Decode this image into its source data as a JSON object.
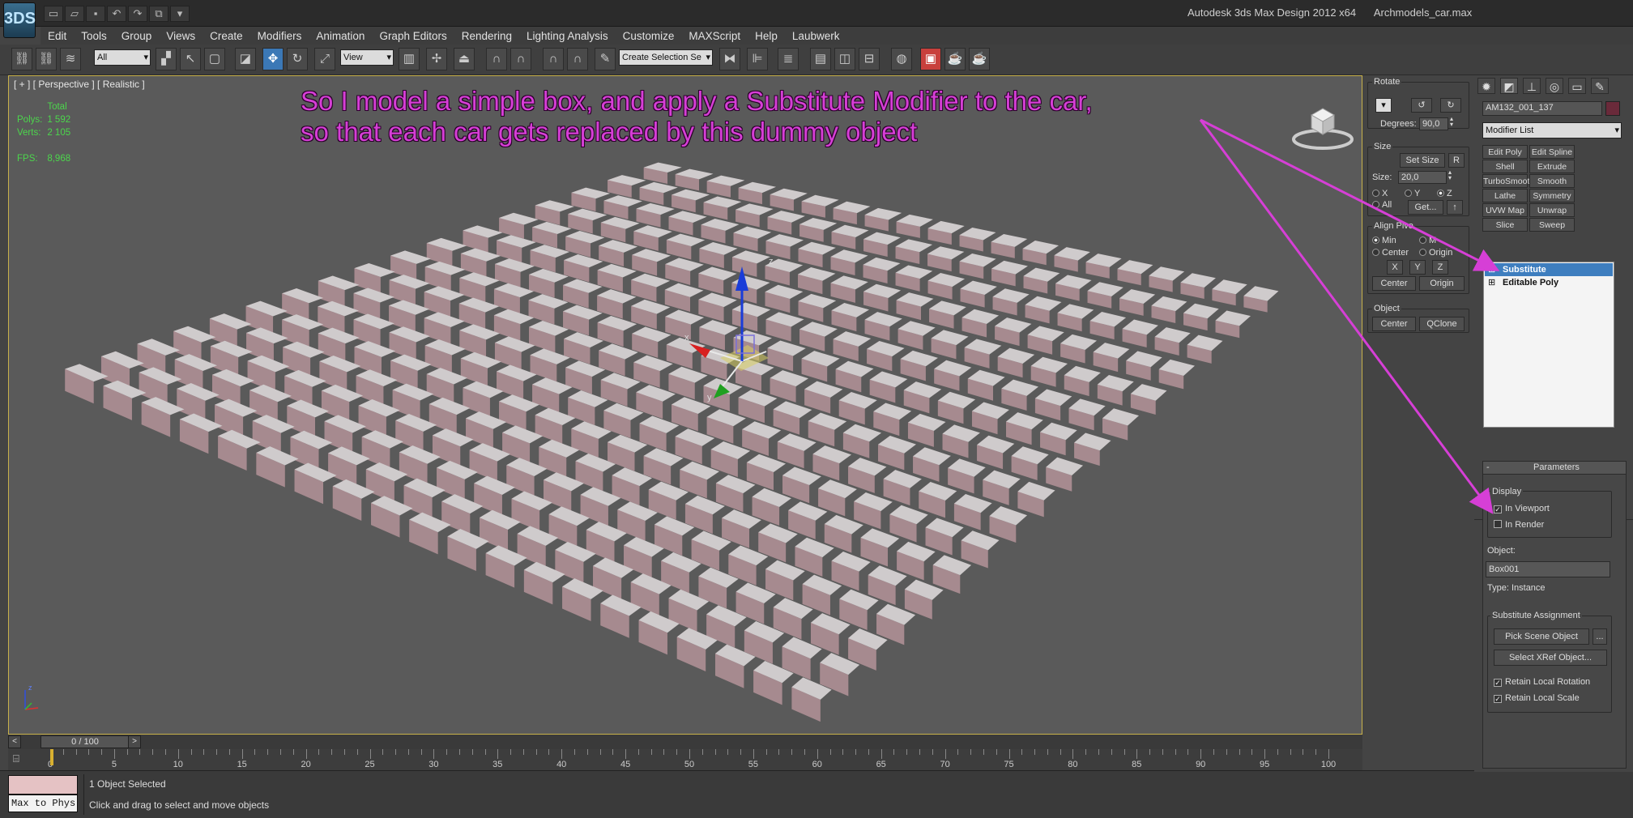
{
  "window": {
    "app_logo": "3DS",
    "title": "Autodesk 3ds Max Design 2012 x64",
    "filename": "Archmodels_car.max"
  },
  "menu": [
    "Edit",
    "Tools",
    "Group",
    "Views",
    "Create",
    "Modifiers",
    "Animation",
    "Graph Editors",
    "Rendering",
    "Lighting Analysis",
    "Customize",
    "MAXScript",
    "Help",
    "Laubwerk"
  ],
  "toolbar": {
    "selection_filter": "All",
    "reference_coord": "View",
    "named_selection": "Create Selection Se"
  },
  "viewport": {
    "label": "[ + ] [ Perspective ] [ Realistic ]",
    "stats": {
      "total_label": "Total",
      "polys_label": "Polys:",
      "polys_value": "1 592",
      "verts_label": "Verts:",
      "verts_value": "2 105",
      "fps_label": "FPS:",
      "fps_value": "8,968"
    },
    "annotation_line1": "So I model a simple box, and apply a Substitute Modifier to the car,",
    "annotation_line2": "so that each car gets replaced by this dummy object",
    "gizmo_z": "z",
    "gizmo_x": "x",
    "gizmo_y": "y",
    "tripod_z": "z"
  },
  "timeline": {
    "frame_display": "0 / 100",
    "prev": "<",
    "next": ">",
    "tick_labels": [
      "0",
      "5",
      "10",
      "15",
      "20",
      "25",
      "30",
      "35",
      "40",
      "45",
      "50",
      "55",
      "60",
      "65",
      "70",
      "75",
      "80",
      "85",
      "90",
      "95",
      "100"
    ]
  },
  "status": {
    "maxscript_label": "Max to Phys",
    "selection": "1 Object Selected",
    "prompt": "Click and drag to select and move objects"
  },
  "align_panel": {
    "rotate_title": "Rotate",
    "degrees_label": "Degrees:",
    "degrees_value": "90,0",
    "size_title": "Size",
    "set_size": "Set Size",
    "r_button": "R",
    "size_label": "Size:",
    "size_value": "20,0",
    "axis_x": "X",
    "axis_y": "Y",
    "axis_z": "Z",
    "axis_all": "All",
    "get_button": "Get...",
    "align_pivot_title": "Align Pivo",
    "min": "Min",
    "max": "M",
    "center": "Center",
    "origin": "Origin",
    "btn_x": "X",
    "btn_y": "Y",
    "btn_z": "Z",
    "btn_center": "Center",
    "btn_origin": "Origin",
    "object_title": "Object",
    "obj_center": "Center",
    "obj_qclone": "QClone"
  },
  "command_panel": {
    "object_name": "AM132_001_137",
    "modifier_list": "Modifier List",
    "modifier_buttons": [
      [
        "Edit Poly",
        "Edit Spline"
      ],
      [
        "Shell",
        "Extrude"
      ],
      [
        "TurboSmooth",
        "Smooth"
      ],
      [
        "Lathe",
        "Symmetry"
      ],
      [
        "UVW Map",
        "Unwrap UVW"
      ],
      [
        "Slice",
        "Sweep"
      ]
    ],
    "stack": [
      {
        "label": "Substitute",
        "selected": true
      },
      {
        "label": "Editable Poly",
        "selected": false
      }
    ],
    "rollout_title": "Parameters",
    "rollout_toggle": "-",
    "display_group": "Display",
    "in_viewport": "In Viewport",
    "in_render": "In Render",
    "object_label": "Object:",
    "object_value": "Box001",
    "type_text": "Type: Instance",
    "assignment_group": "Substitute Assignment",
    "pick_scene": "Pick Scene Object",
    "ellipsis": "...",
    "select_xref": "Select XRef Object...",
    "retain_rotation": "Retain Local Rotation",
    "retain_scale": "Retain Local Scale"
  },
  "colors": {
    "accent_blue": "#3e7ebf",
    "annotation": "#d63fd6",
    "viewport_bg": "#5a5a5a",
    "box_top": "#cfcbcc",
    "box_side": "#a68a8f",
    "stats_green": "#4cd64c"
  }
}
